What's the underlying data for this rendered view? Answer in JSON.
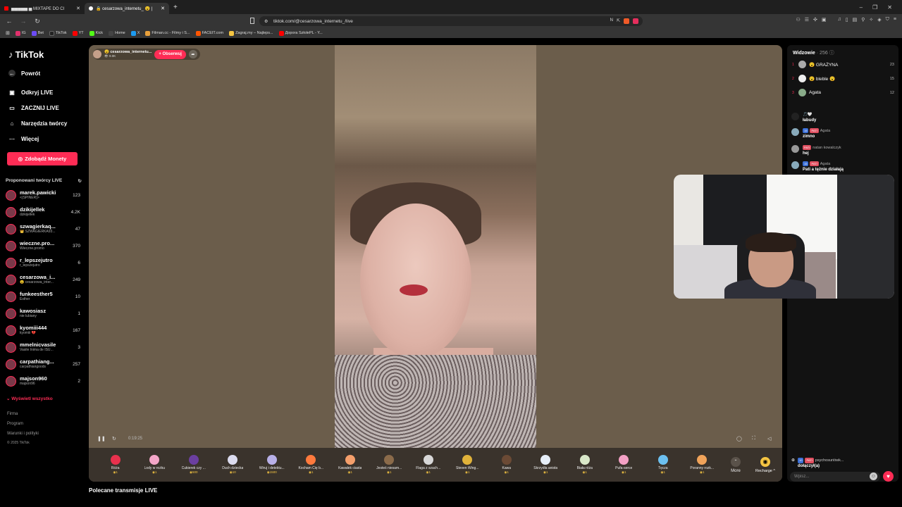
{
  "browser": {
    "tabs": [
      {
        "label": "▅▅▅▅▅ ▅ MIXTAPE DO CI"
      },
      {
        "label": "🔒 cesarzowa_internetu_ 😮 |"
      }
    ],
    "new_tab": "+",
    "url": "tiktok.com/@cesarzowa_internetu_/live",
    "bookmarks": [
      {
        "label": "IG",
        "color": "#e1306c"
      },
      {
        "label": "Bet",
        "color": "#6c4cf5"
      },
      {
        "label": "TikTok",
        "color": "#222222"
      },
      {
        "label": "YT",
        "color": "#ff0000"
      },
      {
        "label": "Kick",
        "color": "#53fc18"
      },
      {
        "label": "Home",
        "color": "#444444"
      },
      {
        "label": "X",
        "color": "#1d9bf0"
      },
      {
        "label": "Filman.cc - Filmy i S...",
        "color": "#e8a03b"
      },
      {
        "label": "FACEIT.com",
        "color": "#ff5500"
      },
      {
        "label": "Zagraj.my – Najleps...",
        "color": "#f5c542"
      },
      {
        "label": "Дорога SzłolePL - Y...",
        "color": "#ff0000"
      }
    ]
  },
  "sidebar": {
    "logo": "TikTok",
    "back": "Powrót",
    "nav": [
      {
        "label": "Odkryj LIVE",
        "icon": "live-icon"
      },
      {
        "label": "ZACZNIJ LIVE",
        "icon": "camera-icon"
      },
      {
        "label": "Narzędzia twórcy",
        "icon": "home-icon"
      },
      {
        "label": "Więcej",
        "icon": "more-icon"
      }
    ],
    "coins_button": "Zdobądź Monety",
    "suggested_title": "Proponowani twórcy LIVE",
    "creators": [
      {
        "name": "marek.pawicki",
        "sub": "<{SPINER}>",
        "count": "123"
      },
      {
        "name": "dzikijellek",
        "sub": "dzikijellek",
        "count": "4.2K"
      },
      {
        "name": "szwagierkaq...",
        "sub": "👑 SZWAGIERKA93...",
        "count": "47"
      },
      {
        "name": "wieczne.pro...",
        "sub": "Wieczne.promo",
        "count": "370"
      },
      {
        "name": "r_lepszejutro",
        "sub": "r_lepszejutro",
        "count": "6"
      },
      {
        "name": "cesarzowa_i...",
        "sub": "😮 cesarzowa_inter...",
        "count": "249"
      },
      {
        "name": "funkeesther5",
        "sub": "Esther",
        "count": "10"
      },
      {
        "name": "kawosiasz",
        "sub": "nie lubiany",
        "count": "1"
      },
      {
        "name": "kyomiii444",
        "sub": "kyomiii 💔",
        "count": "167"
      },
      {
        "name": "mmelnicvasile",
        "sub": "Vasile Inima de ISU...",
        "count": "3"
      },
      {
        "name": "carpathiang...",
        "sub": "carpathiangoods",
        "count": "257"
      },
      {
        "name": "majson960",
        "sub": "majson96",
        "count": "2"
      }
    ],
    "see_all": "Wyświetl wszystko",
    "footer": [
      "Firma",
      "Program",
      "Warunki i polityki",
      "© 2025 TikTok"
    ]
  },
  "live": {
    "streamer_name": "😮 cesarzowa_internetu...",
    "streamer_viewers": "👁 9.0K",
    "follow": "+ Obserwuj",
    "time": "0:19:25",
    "gifts": [
      {
        "name": "Róża",
        "price": "1",
        "color": "#e8314d"
      },
      {
        "name": "Lody w rożku",
        "price": "1",
        "color": "#f4a6c8"
      },
      {
        "name": "Cukierek czy ...",
        "price": "500",
        "color": "#6b3fa0"
      },
      {
        "name": "Duch dziecka",
        "price": "10",
        "color": "#dcdcef"
      },
      {
        "name": "Wiruj i detektu...",
        "price": "1500",
        "color": "#b8b0e8"
      },
      {
        "name": "Kocham Cię b...",
        "price": "1",
        "color": "#ff7a3d"
      },
      {
        "name": "Kawałek ciasta",
        "price": "1",
        "color": "#f59f6b"
      },
      {
        "name": "Jesteś niesam...",
        "price": "1",
        "color": "#8b6b4a"
      },
      {
        "name": "Flaga z szach...",
        "price": "1",
        "color": "#d8d8d8"
      },
      {
        "name": "Steven Wing...",
        "price": "1",
        "color": "#e0b23a"
      },
      {
        "name": "Kawa",
        "price": "1",
        "color": "#6b4a35"
      },
      {
        "name": "Skrzydła anioła",
        "price": "1",
        "color": "#e6eef8"
      },
      {
        "name": "Biała róża",
        "price": "1",
        "color": "#d9e8c8"
      },
      {
        "name": "Pufa-serce",
        "price": "1",
        "color": "#f3a0c4"
      },
      {
        "name": "Tęcza",
        "price": "1",
        "color": "#6cc0f0"
      },
      {
        "name": "Poranny rozk...",
        "price": "1",
        "color": "#f0a35a"
      }
    ],
    "more": "More",
    "recharge": "Recharge ^"
  },
  "recommended_title": "Polecane transmisje LIVE",
  "chat": {
    "viewers_title": "Widzowie",
    "viewers_count": "· 256",
    "top_viewers": [
      {
        "rank": "1",
        "name": "😮 GRAŻYNA",
        "score": "23"
      },
      {
        "rank": "2",
        "name": "😮 bleble 😮",
        "score": "15"
      },
      {
        "rank": "3",
        "name": "Agata",
        "score": "12"
      }
    ],
    "messages": [
      {
        "user": "🎵🤍",
        "text": "łabudy",
        "badges": []
      },
      {
        "user": "Agata",
        "text": "zimno",
        "badges": [
          "15",
          "PATI"
        ]
      },
      {
        "user": "natan kowalczyk",
        "text": "hej",
        "badges": [
          "PATI"
        ]
      },
      {
        "user": "Agata",
        "text": "Pati a tężnie działają",
        "badges": [
          "15",
          "PATI"
        ]
      }
    ],
    "join_user": "psychosuriówk...",
    "join_badges": [
      "10",
      "PATI"
    ],
    "join_text": "dołączył(a)",
    "input_placeholder": "Wpisz..."
  }
}
